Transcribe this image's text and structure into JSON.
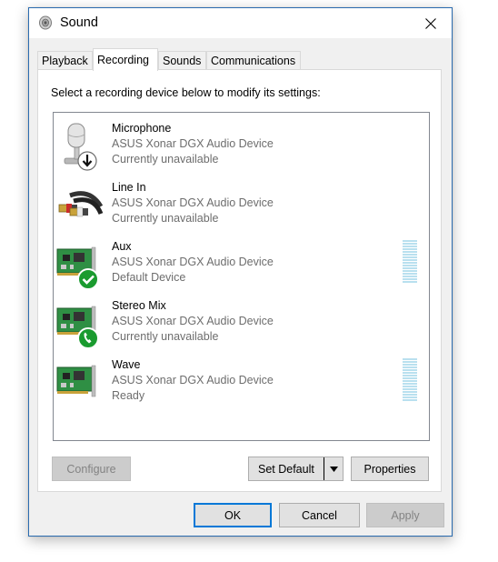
{
  "window": {
    "title": "Sound"
  },
  "tabs": [
    {
      "label": "Playback"
    },
    {
      "label": "Recording"
    },
    {
      "label": "Sounds"
    },
    {
      "label": "Communications"
    }
  ],
  "instruction": "Select a recording device below to modify its settings:",
  "devices": [
    {
      "name": "Microphone",
      "driver": "ASUS Xonar DGX Audio Device",
      "status": "Currently unavailable",
      "icon": "microphone-icon",
      "badge": "down-arrow"
    },
    {
      "name": "Line In",
      "driver": "ASUS Xonar DGX Audio Device",
      "status": "Currently unavailable",
      "icon": "rca-cable-icon",
      "badge": "none"
    },
    {
      "name": "Aux",
      "driver": "ASUS Xonar DGX Audio Device",
      "status": "Default Device",
      "icon": "sound-card-icon",
      "badge": "green-check",
      "level": 0
    },
    {
      "name": "Stereo Mix",
      "driver": "ASUS Xonar DGX Audio Device",
      "status": "Currently unavailable",
      "icon": "sound-card-icon",
      "badge": "green-phone"
    },
    {
      "name": "Wave",
      "driver": "ASUS Xonar DGX Audio Device",
      "status": "Ready",
      "icon": "sound-card-icon",
      "badge": "none",
      "level": 0
    }
  ],
  "panel_buttons": {
    "configure": "Configure",
    "set_default": "Set Default",
    "properties": "Properties"
  },
  "footer_buttons": {
    "ok": "OK",
    "cancel": "Cancel",
    "apply": "Apply"
  },
  "colors": {
    "accent": "#0078d7",
    "meter": "#b9e0ef",
    "badge_green": "#1a9b2f"
  }
}
